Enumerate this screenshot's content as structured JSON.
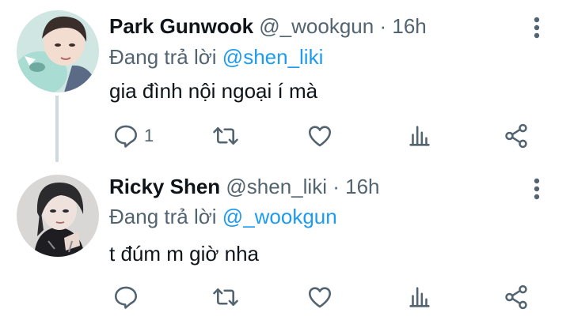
{
  "colors": {
    "link": "#1d9bf0",
    "muted": "#536471",
    "text": "#0f1419",
    "thread_line": "#cfd9de"
  },
  "icons": {
    "reply": "comment-bubble-icon",
    "retweet": "retweet-icon",
    "like": "heart-icon",
    "views": "views-bar-chart-icon",
    "share": "share-icon",
    "more": "more-vertical-icon"
  },
  "tweets": [
    {
      "display_name": "Park Gunwook",
      "handle": "@_wookgun",
      "sep": "·",
      "time": "16h",
      "replying_label": "Đang trả lời",
      "replying_to": "@shen_liki",
      "text": "gia đình nội ngoại í mà",
      "reply_count": "1"
    },
    {
      "display_name": "Ricky Shen",
      "handle": "@shen_liki",
      "sep": "·",
      "time": "16h",
      "replying_label": "Đang trả lời",
      "replying_to": "@_wookgun",
      "text": "t đúm m giờ nha",
      "reply_count": ""
    }
  ]
}
